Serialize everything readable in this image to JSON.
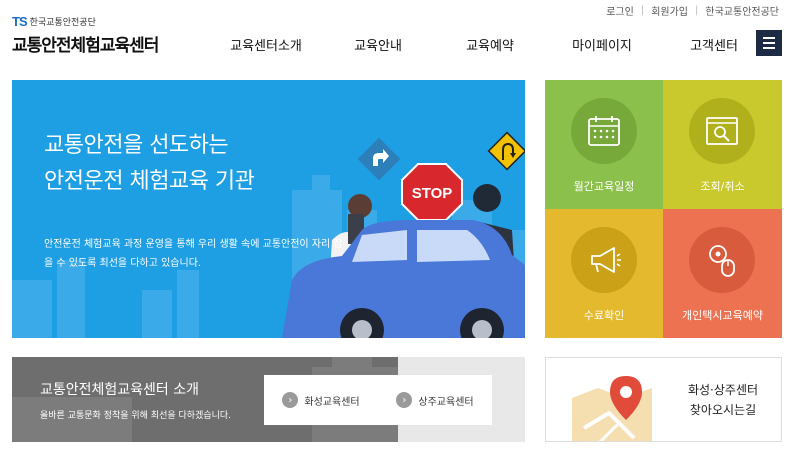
{
  "util_links": [
    "로그인",
    "회원가입",
    "한국교통안전공단"
  ],
  "logo": {
    "mark": "TS",
    "org": "한국교통안전공단",
    "title": "교통안전체험교육센터"
  },
  "gnb": [
    "교육센터소개",
    "교육안내",
    "교육예약",
    "마이페이지",
    "고객센터"
  ],
  "hero": {
    "title_line1": "교통안전을 선도하는",
    "title_line2": "안전운전 체험교육 기관",
    "desc": "안전운전 체험교육 과정 운영을 통해 우리 생활 속에 교통안전이 자리 잡을 수 있도록 최선을 다하고 있습니다.",
    "stop_sign": "STOP",
    "bg_color": "#1e9ee3"
  },
  "tiles": [
    {
      "label": "월간교육일정",
      "icon": "calendar-icon",
      "color": "#8cc04d"
    },
    {
      "label": "조회/취소",
      "icon": "search-window-icon",
      "color": "#c9c92e"
    },
    {
      "label": "수료확인",
      "icon": "megaphone-icon",
      "color": "#e4b92d"
    },
    {
      "label": "개인택시교육예약",
      "icon": "steering-mouse-icon",
      "color": "#ec7252"
    }
  ],
  "intro": {
    "title": "교통안전체험교육센터 소개",
    "desc": "올바른 교통문화 정착을 위해 최선을 다하겠습니다.",
    "links": [
      "화성교육센터",
      "상주교육센터"
    ]
  },
  "map": {
    "line1": "화성·상주센터",
    "line2": "찾아오시는길",
    "icon": "map-pin-icon"
  }
}
